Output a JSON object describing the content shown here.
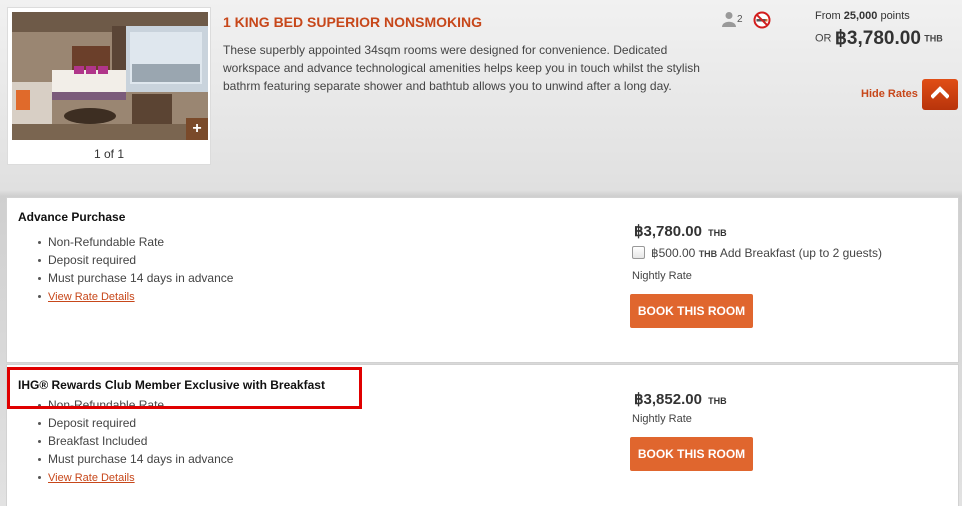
{
  "room": {
    "title": "1 KING BED SUPERIOR NONSMOKING",
    "description": "These superbly appointed 34sqm rooms were designed for convenience. Dedicated workspace and advance technological amenities helps keep you in touch whilst the stylish bathrm featuring separate shower and bathtub allows you to unwind after a long day.",
    "photo_counter": "1 of 1",
    "photo_expand_glyph": "+",
    "max_guests": "2",
    "icons": [
      "guest-icon",
      "no-smoking-icon",
      "chevron-up-icon",
      "plus-icon",
      "checkbox-icon"
    ],
    "points_prefix": "From ",
    "points_value": "25,000",
    "points_suffix": " points",
    "or_label": "OR",
    "from_price": "฿3,780.00",
    "currency": "THB",
    "hide_rates_label": "Hide Rates"
  },
  "rates": [
    {
      "name": "Advance Purchase",
      "features": [
        "Non-Refundable Rate",
        "Deposit required",
        "Must purchase 14 days in advance"
      ],
      "details_link": "View Rate Details",
      "price": "฿3,780.00",
      "currency": "THB",
      "addon_price": "฿500.00",
      "addon_currency": "THB",
      "addon_label": "Add Breakfast (up to 2 guests)",
      "addon_checked": false,
      "nightly_label": "Nightly Rate",
      "book_label": "BOOK THIS ROOM"
    },
    {
      "name": "IHG® Rewards Club Member Exclusive with Breakfast",
      "features": [
        "Non-Refundable Rate",
        "Deposit required",
        "Breakfast Included",
        "Must purchase 14 days in advance"
      ],
      "details_link": "View Rate Details",
      "price": "฿3,852.00",
      "currency": "THB",
      "nightly_label": "Nightly Rate",
      "book_label": "BOOK THIS ROOM"
    }
  ],
  "colors": {
    "accent": "#c7471a",
    "book_button": "#e0662e",
    "highlight": "#e00000"
  }
}
